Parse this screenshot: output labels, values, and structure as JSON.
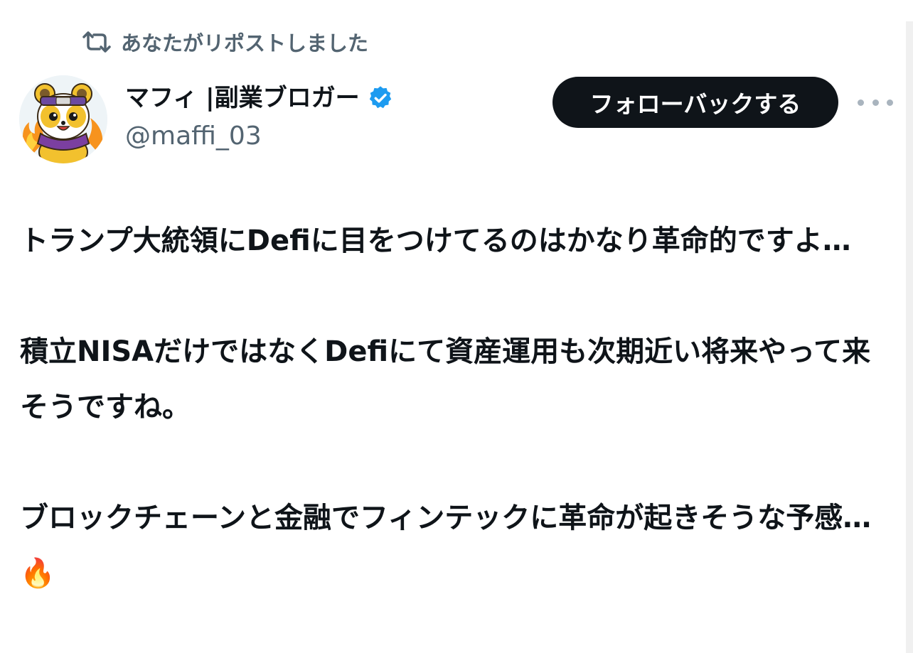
{
  "repost": {
    "text": "あなたがリポストしました",
    "icon": "repost-icon"
  },
  "author": {
    "display_name": "マフィ |副業ブロガー",
    "handle": "@maffi_03",
    "verified_icon": "verified-badge-icon",
    "verified_color": "#1d9bf0"
  },
  "actions": {
    "follow_back_label": "フォローバックする",
    "more_icon": "more-options-icon"
  },
  "tweet": {
    "paragraphs": [
      "トランプ大統領にDefiに目をつけてるのはかなり革命的ですよ…",
      "積立NISAだけではなくDefiにて資産運用も次期近い将来やって来そうですね。",
      "ブロックチェーンと金融でフィンテックに革命が起きそうな予感…🔥"
    ]
  },
  "colors": {
    "text": "#0f1419",
    "secondary": "#536471",
    "button_bg": "#0f1419",
    "button_text": "#ffffff"
  }
}
